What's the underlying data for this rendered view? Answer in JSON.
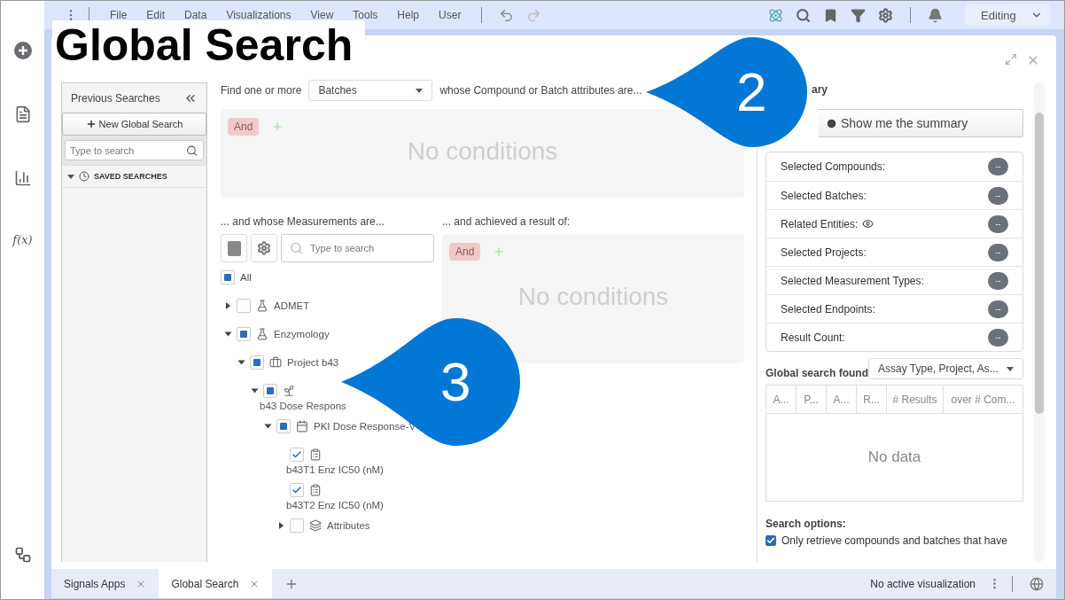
{
  "menu": {
    "items": [
      "File",
      "Edit",
      "Data",
      "Visualizations",
      "View",
      "Tools",
      "Help",
      "User"
    ]
  },
  "mode_select": {
    "value": "Editing"
  },
  "left_rail": {
    "function_label": "f(x)"
  },
  "title_banner": "Global Search",
  "previous_searches": {
    "title": "Previous Searches",
    "new_button": "New Global Search",
    "search": {
      "placeholder": "Type to search"
    },
    "saved_label": "SAVED SEARCHES",
    "saved_expanded": true
  },
  "find": {
    "prefix": "Find one or more",
    "entity": "Batches",
    "suffix": "whose Compound or Batch attributes are...",
    "operator": "And",
    "empty": "No conditions"
  },
  "measurements": {
    "label": "... and whose Measurements are...",
    "search": {
      "placeholder": "Type to search"
    },
    "tree": [
      {
        "label": "All",
        "checked": false,
        "partial": true,
        "children": [
          {
            "label": "ADMET",
            "kind": "flask",
            "checked": false,
            "partial": false,
            "expanded": false,
            "stacked": false
          },
          {
            "label": "Enzymology",
            "kind": "flask",
            "checked": false,
            "partial": true,
            "expanded": true,
            "stacked": false,
            "children": [
              {
                "label": "Project b43",
                "kind": "briefcase",
                "checked": false,
                "partial": true,
                "expanded": true,
                "stacked": false,
                "children": [
                  {
                    "label": "b43 Dose Respons",
                    "kind": "plant",
                    "checked": false,
                    "partial": true,
                    "expanded": true,
                    "stacked": true,
                    "children": [
                      {
                        "label": "PKI Dose Response-V",
                        "kind": "calendar",
                        "checked": false,
                        "partial": true,
                        "expanded": true,
                        "stacked": false,
                        "children": [
                          {
                            "label": "b43T1 Enz IC50 (nM)",
                            "kind": "clipboard",
                            "checked": true,
                            "stacked": true
                          },
                          {
                            "label": "b43T2 Enz IC50 (nM)",
                            "kind": "clipboard",
                            "checked": true,
                            "stacked": true
                          },
                          {
                            "label": "Attributes",
                            "kind": "layers",
                            "checked": false,
                            "partial": false,
                            "expanded": false,
                            "stacked": false
                          }
                        ]
                      }
                    ]
                  }
                ]
              }
            ]
          }
        ]
      }
    ]
  },
  "results": {
    "label": "... and achieved a result of:",
    "operator": "And",
    "empty": "No conditions"
  },
  "summary": {
    "heading": "ary",
    "button": "Show me the summary",
    "rows": [
      {
        "label": "Selected Compounds:",
        "value": "--",
        "eye": false
      },
      {
        "label": "Selected Batches:",
        "value": "--",
        "eye": false
      },
      {
        "label": "Related Entities:",
        "value": "--",
        "eye": true
      },
      {
        "label": "Selected Projects:",
        "value": "--",
        "eye": false
      },
      {
        "label": "Selected Measurement Types:",
        "value": "--",
        "eye": false
      },
      {
        "label": "Selected Endpoints:",
        "value": "--",
        "eye": false
      },
      {
        "label": "Result Count:",
        "value": "--",
        "eye": false
      }
    ]
  },
  "found": {
    "label": "Global search found",
    "grouping": "Assay Type, Project, As...",
    "columns": [
      "A...",
      "P...",
      "A...",
      "R...",
      "# Results",
      "over # Com..."
    ],
    "empty": "No data"
  },
  "options": {
    "label": "Search options:",
    "items": [
      {
        "label": "Only retrieve compounds and batches that have",
        "checked": true
      }
    ]
  },
  "tabs": [
    {
      "label": "Signals Apps",
      "selected": false
    },
    {
      "label": "Global Search",
      "selected": true
    }
  ],
  "status": "No active visualization",
  "callouts": [
    "2",
    "3"
  ]
}
